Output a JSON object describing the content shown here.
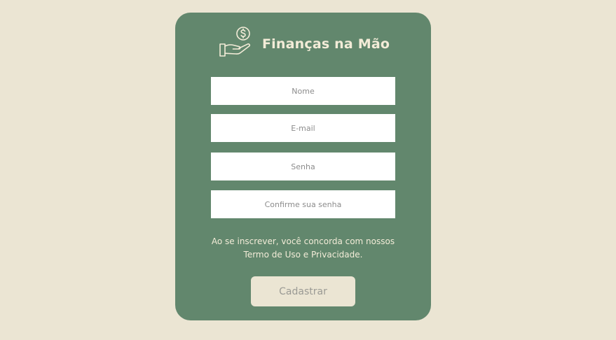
{
  "colors": {
    "page_background": "#ebe5d3",
    "card_background": "#62876d",
    "accent_text": "#f3ecd8",
    "input_background": "#ffffff",
    "button_background": "#ebe5d3",
    "button_text": "#9a9a94"
  },
  "brand": {
    "icon": "hand-holding-coin-icon",
    "title": "Finanças na Mão"
  },
  "form": {
    "fields": [
      {
        "name": "nome",
        "placeholder": "Nome",
        "value": ""
      },
      {
        "name": "email",
        "placeholder": "E-mail",
        "value": ""
      },
      {
        "name": "senha",
        "placeholder": "Senha",
        "value": ""
      },
      {
        "name": "confirme-senha",
        "placeholder": "Confirme sua senha",
        "value": ""
      }
    ],
    "terms_line1": "Ao se inscrever, você concorda com nossos",
    "terms_line2": "Termo de Uso e Privacidade.",
    "submit_label": "Cadastrar"
  }
}
